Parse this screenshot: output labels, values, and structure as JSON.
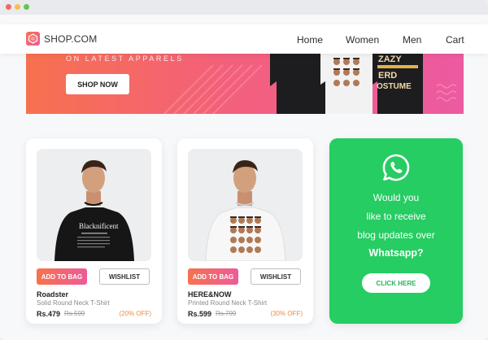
{
  "brand": {
    "name": "SHOP.COM",
    "accent": "#f4665c"
  },
  "nav": {
    "items": [
      "Home",
      "Women",
      "Men",
      "Cart"
    ]
  },
  "banner": {
    "subtitle": "ON LATEST APPARELS",
    "button_label": "SHOP NOW",
    "shirt_texts": {
      "right_top": "ZAZY",
      "right_mid": "ERD",
      "right_bottom": "OSTUME"
    }
  },
  "products": [
    {
      "name": "Roadster",
      "description": "Solid Round Neck T-Shirt",
      "price": "Rs.479",
      "old_price": "Rs.599",
      "discount": "(20% OFF)",
      "add_label": "ADD TO BAG",
      "wishlist_label": "WISHLIST",
      "shirt_print": "Blacknificent"
    },
    {
      "name": "HERE&NOW",
      "description": "Printed Round Neck T-Shirt",
      "price": "Rs.599",
      "old_price": "Rs.799",
      "discount": "(30% OFF)",
      "add_label": "ADD TO BAG",
      "wishlist_label": "WISHLIST"
    }
  ],
  "whatsapp": {
    "lines": [
      "Would you",
      "like to receive",
      "blog updates over",
      "Whatsapp?"
    ],
    "button_label": "CLICK HERE",
    "color": "#25cd62"
  },
  "window_controls": [
    "close-dot",
    "minimize-dot",
    "maximize-dot"
  ]
}
